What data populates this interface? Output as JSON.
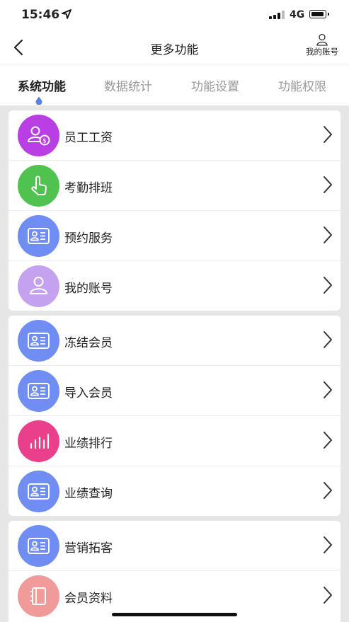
{
  "status": {
    "time": "15:46",
    "network": "4G"
  },
  "nav": {
    "title": "更多功能",
    "account_label": "我的账号"
  },
  "tabs": [
    {
      "label": "系统功能",
      "active": true
    },
    {
      "label": "数据统计",
      "active": false
    },
    {
      "label": "功能设置",
      "active": false
    },
    {
      "label": "功能权限",
      "active": false
    }
  ],
  "groups": [
    [
      {
        "label": "员工工资",
        "icon": "salary-icon",
        "color": "#b93ee3"
      },
      {
        "label": "考勤排班",
        "icon": "tap-hand-icon",
        "color": "#4fc24f"
      },
      {
        "label": "预约服务",
        "icon": "id-card-icon",
        "color": "#6f8df2"
      },
      {
        "label": "我的账号",
        "icon": "user-icon",
        "color": "#c4a2f0"
      }
    ],
    [
      {
        "label": "冻结会员",
        "icon": "id-card-icon",
        "color": "#6f8df2"
      },
      {
        "label": "导入会员",
        "icon": "id-card-icon",
        "color": "#6f8df2"
      },
      {
        "label": "业绩排行",
        "icon": "bar-chart-icon",
        "color": "#ea3f8b"
      },
      {
        "label": "业绩查询",
        "icon": "id-card-icon",
        "color": "#6f8df2"
      }
    ],
    [
      {
        "label": "营销拓客",
        "icon": "id-card-icon",
        "color": "#6f8df2"
      },
      {
        "label": "会员资料",
        "icon": "notebook-icon",
        "color": "#f19a9a"
      }
    ]
  ]
}
